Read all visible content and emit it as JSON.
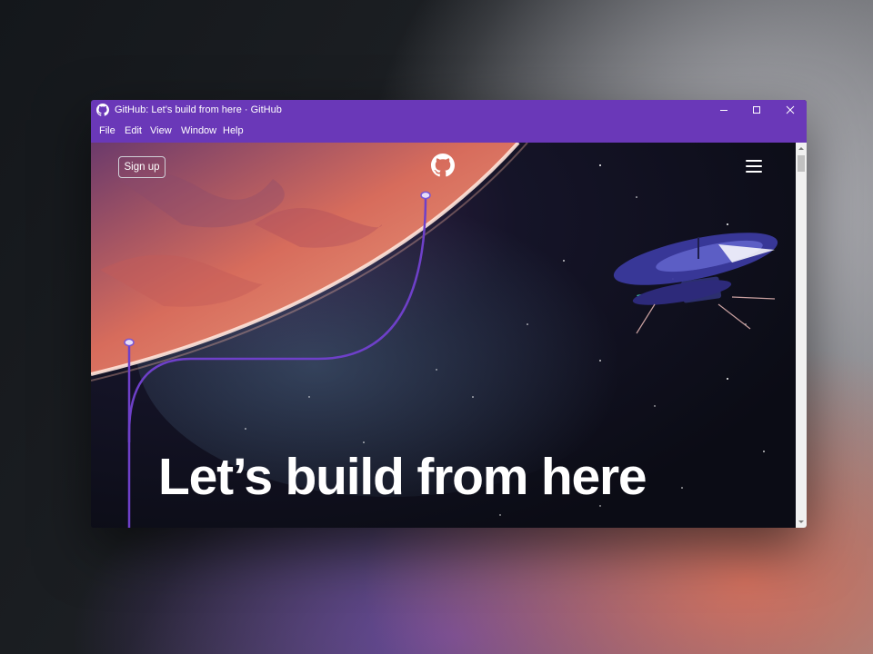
{
  "window": {
    "title": "GitHub: Let’s build from here · GitHub",
    "app_icon": "github-icon",
    "controls": [
      "minimize-icon",
      "maximize-icon",
      "close-icon"
    ]
  },
  "menubar": {
    "items": [
      "File",
      "Edit",
      "View",
      "Window",
      "Help"
    ]
  },
  "page": {
    "signup_label": "Sign up",
    "logo_icon": "github-mark-icon",
    "menu_icon": "hamburger-icon",
    "hero_heading": "Let’s build from here"
  },
  "colors": {
    "titlebar": "#6a38b8",
    "page_background": "#0c0d1a",
    "accent_line": "#6e40c9",
    "planet": "#e07a5f"
  }
}
